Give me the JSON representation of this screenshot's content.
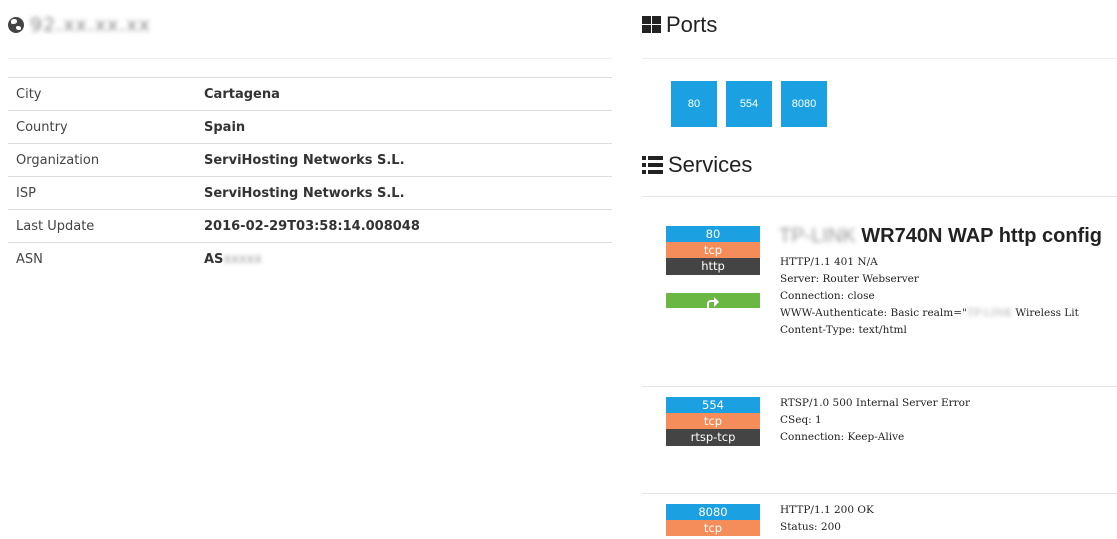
{
  "host": {
    "ip": "92.xx.xx.xx"
  },
  "general_info": [
    {
      "label": "City",
      "value": "Cartagena"
    },
    {
      "label": "Country",
      "value": "Spain"
    },
    {
      "label": "Organization",
      "value": "ServiHosting Networks S.L."
    },
    {
      "label": "ISP",
      "value": "ServiHosting Networks S.L."
    },
    {
      "label": "Last Update",
      "value": "2016-02-29T03:58:14.008048"
    },
    {
      "label": "ASN",
      "value": "AS",
      "redacted_suffix": "xxxxx"
    }
  ],
  "ports_section": {
    "title": "Ports",
    "icon": "th-large-icon",
    "ports": [
      "80",
      "554",
      "8080"
    ]
  },
  "services_section": {
    "title": "Services",
    "icon": "list-icon",
    "services": [
      {
        "port": "80",
        "protocol": "tcp",
        "service": "http",
        "title_redacted": "TP-LINK",
        "title": "WR740N WAP http config",
        "banner": [
          "HTTP/1.1 401 N/A",
          "Server: Router Webserver",
          "Connection: close",
          "WWW-Authenticate: Basic realm=\"",
          "Content-Type: text/html"
        ],
        "banner_redacted": "TP-LINK",
        "banner_tail": "Wireless Lit"
      },
      {
        "port": "554",
        "protocol": "tcp",
        "service": "rtsp-tcp",
        "banner": [
          "RTSP/1.0 500 Internal Server Error",
          "CSeq: 1",
          "Connection: Keep-Alive"
        ]
      },
      {
        "port": "8080",
        "protocol": "tcp",
        "banner": [
          "HTTP/1.1 200 OK",
          "Status: 200"
        ]
      }
    ]
  },
  "colors": {
    "port_tag": "#1ba1e2",
    "protocol_tag": "#f58d5b",
    "service_tag": "#444444",
    "link_button": "#6ab744"
  }
}
